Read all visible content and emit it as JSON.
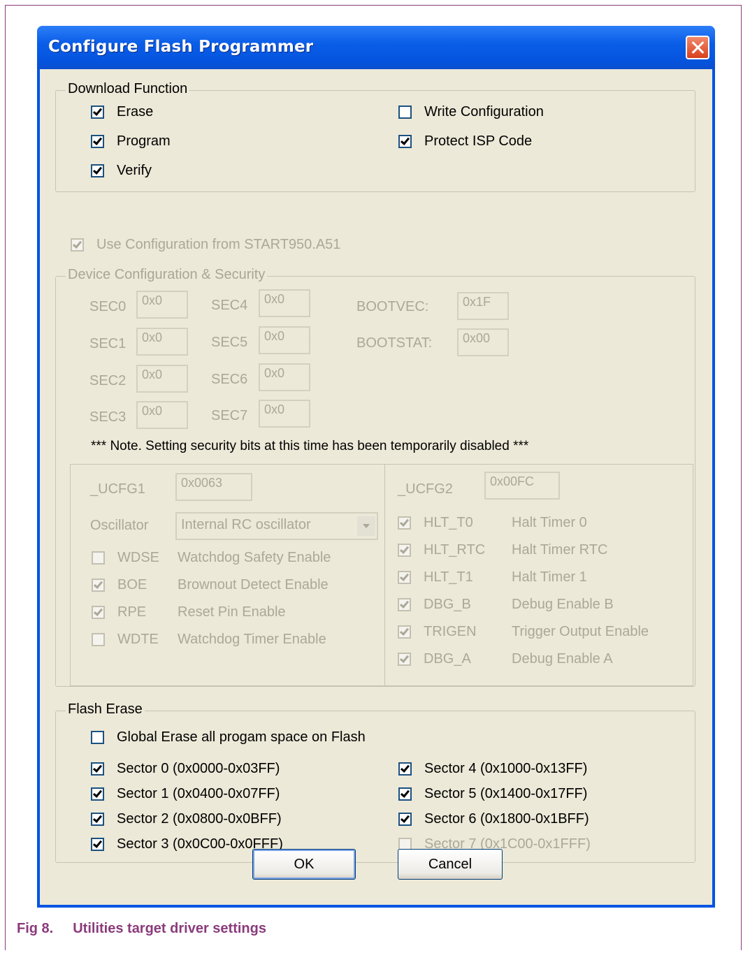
{
  "dialog": {
    "title": "Configure Flash Programmer"
  },
  "download_function": {
    "legend": "Download Function",
    "erase": "Erase",
    "program": "Program",
    "verify": "Verify",
    "write_configuration": "Write Configuration",
    "protect_isp": "Protect ISP Code"
  },
  "use_config": "Use Configuration from START950.A51",
  "device_config": {
    "legend": "Device Configuration & Security",
    "sec": [
      {
        "label": "SEC0",
        "value": "0x0"
      },
      {
        "label": "SEC1",
        "value": "0x0"
      },
      {
        "label": "SEC2",
        "value": "0x0"
      },
      {
        "label": "SEC3",
        "value": "0x0"
      },
      {
        "label": "SEC4",
        "value": "0x0"
      },
      {
        "label": "SEC5",
        "value": "0x0"
      },
      {
        "label": "SEC6",
        "value": "0x0"
      },
      {
        "label": "SEC7",
        "value": "0x0"
      }
    ],
    "bootvec": {
      "label": "BOOTVEC:",
      "value": "0x1F"
    },
    "bootstat": {
      "label": "BOOTSTAT:",
      "value": "0x00"
    },
    "note": "*** Note. Setting security bits at this time has been temporarily disabled ***",
    "ucfg1": {
      "label": "_UCFG1",
      "value": "0x0063",
      "oscillator_label": "Oscillator",
      "oscillator_value": "Internal RC oscillator",
      "options": [
        {
          "code": "WDSE",
          "desc": "Watchdog Safety Enable"
        },
        {
          "code": "BOE",
          "desc": "Brownout Detect Enable"
        },
        {
          "code": "RPE",
          "desc": "Reset Pin Enable"
        },
        {
          "code": "WDTE",
          "desc": "Watchdog Timer Enable"
        }
      ]
    },
    "ucfg2": {
      "label": "_UCFG2",
      "value": "0x00FC",
      "options": [
        {
          "code": "HLT_T0",
          "desc": "Halt Timer 0"
        },
        {
          "code": "HLT_RTC",
          "desc": "Halt Timer RTC"
        },
        {
          "code": "HLT_T1",
          "desc": "Halt Timer 1"
        },
        {
          "code": "DBG_B",
          "desc": "Debug Enable B"
        },
        {
          "code": "TRIGEN",
          "desc": "Trigger Output Enable"
        },
        {
          "code": "DBG_A",
          "desc": "Debug Enable A"
        }
      ]
    }
  },
  "flash_erase": {
    "legend": "Flash Erase",
    "global": "Global Erase all progam space on Flash",
    "sectors": [
      "Sector 0 (0x0000-0x03FF)",
      "Sector 1 (0x0400-0x07FF)",
      "Sector 2 (0x0800-0x0BFF)",
      "Sector 3 (0x0C00-0x0FFF)",
      "Sector 4 (0x1000-0x13FF)",
      "Sector 5 (0x1400-0x17FF)",
      "Sector 6 (0x1800-0x1BFF)",
      "Sector 7 (0x1C00-0x1FFF)"
    ]
  },
  "buttons": {
    "ok": "OK",
    "cancel": "Cancel"
  },
  "caption": {
    "number": "Fig 8.",
    "title": "Utilities target driver settings"
  }
}
